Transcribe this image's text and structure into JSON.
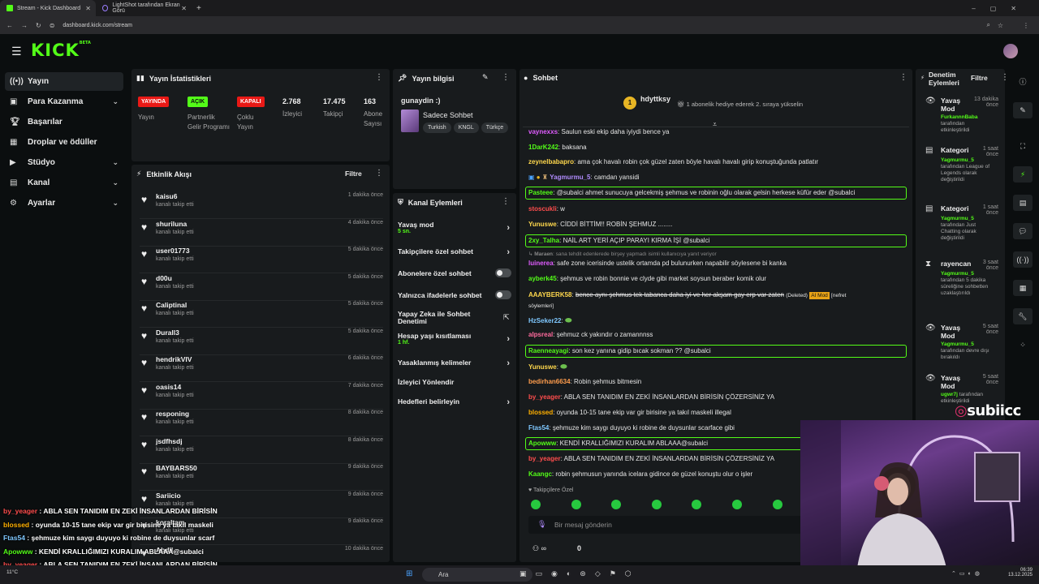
{
  "browser": {
    "tabs": [
      {
        "label": "Stream - Kick Dashboard"
      },
      {
        "label": "LightShot tarafından Ekran Görü"
      }
    ],
    "url": "dashboard.kick.com/stream"
  },
  "brand": {
    "logo": "KICK",
    "logo_sup": "BETA"
  },
  "sidebar": {
    "items": [
      {
        "label": "Yayın",
        "icon": "broadcast-icon"
      },
      {
        "label": "Para Kazanma",
        "icon": "wallet-icon"
      },
      {
        "label": "Başarılar",
        "icon": "trophy-icon"
      },
      {
        "label": "Droplar ve ödüller",
        "icon": "gift-icon"
      },
      {
        "label": "Stüdyo",
        "icon": "play-icon"
      },
      {
        "label": "Kanal",
        "icon": "channel-icon"
      },
      {
        "label": "Ayarlar",
        "icon": "gear-icon"
      }
    ]
  },
  "stats": {
    "title": "Yayın İstatistikleri",
    "items": [
      {
        "badge": "YAYINDA",
        "label": "Yayın"
      },
      {
        "badge": "AÇIK",
        "label": "Partnerlik Gelir Programı"
      },
      {
        "badge": "KAPALI",
        "label": "Çoklu Yayın"
      },
      {
        "value": "2.768",
        "label": "İzleyici"
      },
      {
        "value": "17.475",
        "label": "Takipçi"
      },
      {
        "value": "163",
        "label": "Abone Sayısı"
      }
    ]
  },
  "activity": {
    "title": "Etkinlik Akışı",
    "filter": "Filtre",
    "items": [
      {
        "name": "kaisu6",
        "action": "kanalı takip etti",
        "time": "1 dakika önce"
      },
      {
        "name": "shuriluna",
        "action": "kanalı takip etti",
        "time": "4 dakika önce"
      },
      {
        "name": "user01773",
        "action": "kanalı takip etti",
        "time": "5 dakika önce"
      },
      {
        "name": "d00u",
        "action": "kanalı takip etti",
        "time": "5 dakika önce"
      },
      {
        "name": "Caliptinal",
        "action": "kanalı takip etti",
        "time": "5 dakika önce"
      },
      {
        "name": "Durall3",
        "action": "kanalı takip etti",
        "time": "5 dakika önce"
      },
      {
        "name": "hendrikVIV",
        "action": "kanalı takip etti",
        "time": "6 dakika önce"
      },
      {
        "name": "oasis14",
        "action": "kanalı takip etti",
        "time": "7 dakika önce"
      },
      {
        "name": "responing",
        "action": "kanalı takip etti",
        "time": "8 dakika önce"
      },
      {
        "name": "jsdfhsdj",
        "action": "kanalı takip etti",
        "time": "8 dakika önce"
      },
      {
        "name": "BAYBARS50",
        "action": "kanalı takip etti",
        "time": "9 dakika önce"
      },
      {
        "name": "Sariicio",
        "action": "kanalı takip etti",
        "time": "9 dakika önce"
      },
      {
        "name": "koraltam",
        "action": "kanalı takip etti",
        "time": "9 dakika önce"
      },
      {
        "name": "Abdll..",
        "action": "",
        "time": "10 dakika önce"
      }
    ]
  },
  "stream_info": {
    "title": "Yayın bilgisi",
    "stream_title": "gunaydin :)",
    "category": "Sadece Sohbet",
    "tags": [
      "Turkish",
      "KNGL",
      "Türkçe"
    ]
  },
  "channel_actions": {
    "title": "Kanal Eylemleri",
    "items": [
      {
        "label": "Yavaş mod",
        "value": "5 sn."
      },
      {
        "label": "Takipçilere özel sohbet",
        "value": ""
      },
      {
        "label": "Abonelere özel sohbet",
        "value": ""
      },
      {
        "label": "Yalnızca ifadelerle sohbet",
        "value": ""
      },
      {
        "label": "Yapay Zeka ile Sohbet Denetimi",
        "value": ""
      },
      {
        "label": "Hesap yaşı kısıtlaması",
        "value": "1 hf."
      },
      {
        "label": "Yasaklanmış kelimeler",
        "value": ""
      },
      {
        "label": "İzleyici Yönlendir",
        "value": ""
      },
      {
        "label": "Hedefleri belirleyin",
        "value": ""
      }
    ]
  },
  "chat": {
    "title": "Sohbet",
    "pinned_user": "hdyttksy",
    "pinned_count": "1",
    "gift_text": "1 abonelik hediye ederek 2. sıraya yükselin",
    "messages": [
      {
        "user": "vaynexxs",
        "text": "Saulun eski ekip daha iyiydi bence ya",
        "color": "#e05cff"
      },
      {
        "user": "1DarK242",
        "text": "baksana",
        "color": "#53fc18"
      },
      {
        "user": "zeynelbabapro",
        "text": "ama çok havalı robin çok güzel zaten böyle havalı havalı girip konuştuğunda patlatır",
        "color": "#ffd84d"
      },
      {
        "user": "Yagmurmu_5",
        "text": "camdan yansidi",
        "color": "#b18cff"
      },
      {
        "user": "Pasteee",
        "text": "@subalci ahmet sunucuya gelcekmiş şehmus ve robinin oğlu olarak gelsin herkese küfür eder @subalci",
        "color": "#53fc18"
      },
      {
        "user": "stoscukli",
        "text": "w",
        "color": "#ff4d4d"
      },
      {
        "user": "Yunuswe",
        "text": "CİDDİ BİTTİM!! ROBİN ŞEHMUZ ........",
        "color": "#ffd84d"
      },
      {
        "user": "2xy_Talha",
        "text": "NAİL ART YERİ AÇIP PARAYI KIRMA İŞİ @subalci",
        "color": "#53fc18"
      },
      {
        "user": "Maraen",
        "text": "sana tehdit edenlerede birşey yapmadı isimli kullanıcıya yanıt veriyor",
        "color": "#888888"
      },
      {
        "user": "luinerea",
        "text": "safe zone icerisinde ustelik ortamda pd bulunurken napabilir söylesene bi kanka",
        "color": "#e05cff"
      },
      {
        "user": "ayberk45",
        "text": "şehmus ve robin bonnie ve clyde gibi market soysun beraber komik olur",
        "color": "#53fc18"
      },
      {
        "user": "AAAYBERK58",
        "text": "bence aynı şehmus tek tabanca daha iyi ve her akşam gay erp var zaten",
        "color": "#ffd84d"
      },
      {
        "user": "HzSeker22",
        "text": "",
        "color": "#7fc8ff"
      },
      {
        "user": "alpsreal",
        "text": "şehmuz ck yakındır o zamannnss",
        "color": "#ff6b9d"
      },
      {
        "user": "Raenneayagi",
        "text": "son kez yanına gidip bıcak sokman ?? @subalci",
        "color": "#53fc18"
      },
      {
        "user": "Yunuswe",
        "text": "",
        "color": "#ffd84d"
      },
      {
        "user": "bedirhan6634",
        "text": "Robin şehmus bitmesin",
        "color": "#ff9d4d"
      },
      {
        "user": "by_yeager",
        "text": "ABLA SEN TANIDIM EN ZEKİ İNSANLARDAN BİRİSİN ÇÖZERSİNİZ YA",
        "color": "#ff4d4d"
      },
      {
        "user": "blossed",
        "text": "oyunda 10-15 tane ekip var gir birisine ya takıl maskeli illegal",
        "color": "#ffb000"
      },
      {
        "user": "Ftas54",
        "text": "şehmuze kim saygı duyuyo ki robine de duysunlar scarface gibi",
        "color": "#7fc8ff"
      },
      {
        "user": "Apowww",
        "text": "KENDİ KRALLIĞIMIZI KURALIM ABLAAA@subalci",
        "color": "#53fc18"
      },
      {
        "user": "by_yeager",
        "text": "ABLA SEN TANIDIM EN ZEKİ İNSANLARDAN BİRİSİN ÇÖZERSİNİZ YA",
        "color": "#ff4d4d"
      },
      {
        "user": "Kaangc",
        "text": "robin şehmusun yanında icelara gidince de güzel konuştu olur o işler",
        "color": "#53fc18"
      }
    ],
    "deleted_label": "(Deleted)",
    "mod_label": "AI Mod",
    "hidden_label": "[nefret söylemleri]",
    "follower_only": "Takipçilere Özel",
    "input_placeholder": "Bir mesaj gönderin",
    "viewer_count": "0"
  },
  "moderation": {
    "title": "Denetim Eylemleri",
    "filter": "Filtre",
    "items": [
      {
        "title": "Yavaş Mod",
        "time": "13 dakika önce",
        "user": "FurkannnBaba",
        "desc": "tarafından etkinleştirildi"
      },
      {
        "title": "Kategori",
        "time": "1 saat önce",
        "user": "Yagmurmu_5",
        "desc": "tarafından League of Legends olarak değiştirildi"
      },
      {
        "title": "Kategori",
        "time": "1 saat önce",
        "user": "Yagmurmu_5",
        "desc": "tarafından Just Chatting olarak değiştirildi"
      },
      {
        "title": "rayencan",
        "time": "3 saat önce",
        "user": "Yagmurmu_5",
        "desc": "tarafından 5 dakika süreliğine sohbetten uzaklaştırıldı"
      },
      {
        "title": "Yavaş Mod",
        "time": "5 saat önce",
        "user": "Yagmurmu_5",
        "desc": "tarafından devre dışı bırakıldı"
      },
      {
        "title": "Yavaş Mod",
        "time": "5 saat önce",
        "user": "ugwr7j",
        "desc": "tarafından etkinleştirildi"
      }
    ]
  },
  "overlay": {
    "watermark": "subiicc",
    "lines": [
      {
        "user": "by_yeager",
        "text": "ABLA SEN TANIDIM EN ZEKİ İNSANLARDAN BİRİSİN"
      },
      {
        "user": "blossed",
        "text": "oyunda 10-15 tane ekip var gir birisine ya takıl maskeli"
      },
      {
        "user": "Ftas54",
        "text": "şehmuze kim saygı duyuyo ki robine de duysunlar scarf"
      },
      {
        "user": "Apowww",
        "text": "KENDİ KRALLIĞIMIZI KURALIM ABLAAA@subalci"
      },
      {
        "user": "by_yeager",
        "text": "ABLA SEN TANIDIM EN ZEKİ İNSANLARDAN BİRİSİN"
      },
      {
        "user": "Kaangc",
        "text": "robin şehmusun yanında icelara gidince de güzel konuş"
      }
    ]
  },
  "taskbar": {
    "search": "Ara",
    "time": "06:39",
    "date": "13.12.2025",
    "weather": "11°C"
  },
  "colors": {
    "accent": "#53fc18",
    "live": "#e91916",
    "panel": "#181b1d",
    "background": "#0b0e0f"
  }
}
